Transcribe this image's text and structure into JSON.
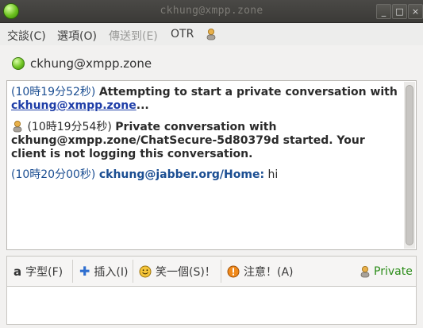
{
  "window": {
    "title": "ckhung@xmpp.zone",
    "controls": [
      "_",
      "□",
      "×"
    ]
  },
  "menubar": {
    "items": [
      {
        "label": "交談(C)",
        "enabled": true
      },
      {
        "label": "選項(O)",
        "enabled": true
      },
      {
        "label": "傳送到(E)",
        "enabled": false
      },
      {
        "label": "OTR",
        "enabled": true
      }
    ],
    "otr_icon": "otr-person-icon"
  },
  "header": {
    "status": "available",
    "contact": "ckhung@xmpp.zone"
  },
  "conversation": {
    "messages": [
      {
        "time": "(10時19分52秒)",
        "text": "Attempting to start a private conversation with",
        "link": "ckhung@xmpp.zone",
        "after_link": "..."
      },
      {
        "icon": "otr-person-icon",
        "time": "(10時19分54秒)",
        "text": "Private conversation with ckhung@xmpp.zone/ChatSecure-5d80379d started.  Your client is not logging this conversation."
      },
      {
        "time": "(10時20分00秒)",
        "nick": "ckhung@jabber.org/Home:",
        "text": "hi"
      }
    ]
  },
  "toolbar": {
    "font_label": "字型(F)",
    "insert_label": "插入(I)",
    "smile_label": "笑一個(S)！",
    "attention_label": "注意！(A)",
    "private_label": "Private"
  },
  "colors": {
    "timestamp": "#1b4e92",
    "link": "#1f3ea8",
    "private": "#2a8c18",
    "status_available": "#72c524"
  }
}
